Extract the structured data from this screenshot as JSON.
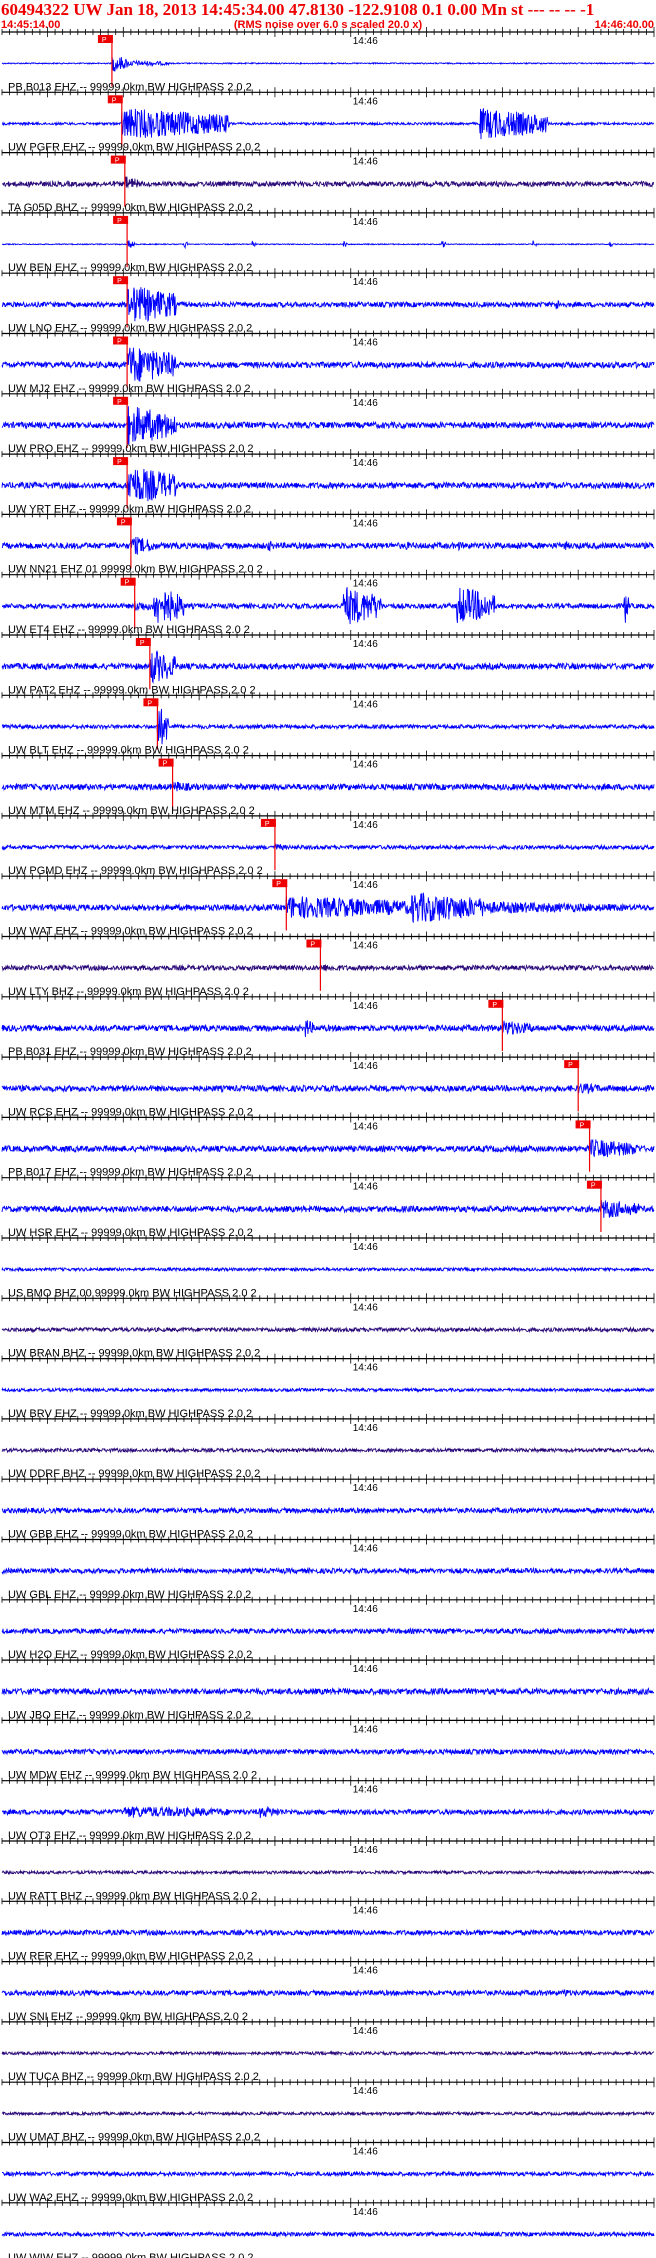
{
  "header": {
    "title": "60494322 UW Jan 18, 2013 14:45:34.00   47.8130 -122.9108  0.1 0.00 Mn st --- -- --  -1",
    "subtitle": "(RMS noise over 6.0 s scaled 20.0 x)",
    "time_start": "14:45:14.00",
    "time_end": "14:46:40.00"
  },
  "colors": {
    "trace": "#0000ff",
    "noisy_trace": "#2a0a7a",
    "pick": "#ee0000",
    "text": "#000000"
  },
  "chart_data": {
    "type": "seismogram-stack",
    "x_range": [
      "14:45:14.00",
      "14:46:40.00"
    ],
    "minute_label": "14:46",
    "pick_label": "P",
    "traces": [
      {
        "label": "",
        "pick": 14.5,
        "bursts": [
          [
            14.5,
            16.5,
            9
          ],
          [
            16.5,
            22,
            3
          ]
        ],
        "noise": 0.6,
        "color": "trace"
      },
      {
        "label": "PB B013 EHZ -- 99999.0km BW  HIGHPASS  2.0  2",
        "pick": 15.8,
        "bursts": [
          [
            15.8,
            30,
            16
          ],
          [
            63,
            72,
            16
          ]
        ],
        "noise": 1.2,
        "color": "trace"
      },
      {
        "label": "UW PGFR EHZ -- 99999.0km BW  HIGHPASS  2.0  2",
        "pick": 16.2,
        "bursts": [
          [
            16.2,
            18,
            8
          ]
        ],
        "noise": 2.5,
        "color": "noisy_trace"
      },
      {
        "label": "TA G05D BHZ -- 99999.0km BW  HIGHPASS  2.0  2",
        "pick": 16.5,
        "bursts": [
          [
            16.5,
            17.5,
            5
          ],
          [
            24,
            24.5,
            4
          ],
          [
            33,
            33.5,
            4
          ],
          [
            45,
            45.5,
            4
          ],
          [
            58,
            58.5,
            4
          ],
          [
            70,
            70.5,
            4
          ],
          [
            80,
            80.5,
            4
          ]
        ],
        "noise": 0.5,
        "color": "trace"
      },
      {
        "label": "UW BEN EHZ -- 99999.0km BW  HIGHPASS  2.0  2",
        "pick": 16.5,
        "bursts": [
          [
            16.5,
            23,
            20
          ],
          [
            73,
            74,
            6
          ]
        ],
        "noise": 2.5,
        "color": "trace"
      },
      {
        "label": "UW LNO EHZ -- 99999.0km BW  HIGHPASS  2.0  2",
        "pick": 16.5,
        "bursts": [
          [
            16.5,
            23,
            20
          ]
        ],
        "noise": 3,
        "color": "trace"
      },
      {
        "label": "UW MJ2 EHZ -- 99999.0km BW  HIGHPASS  2.0  2",
        "pick": 16.5,
        "bursts": [
          [
            16.5,
            23,
            20
          ]
        ],
        "noise": 3,
        "color": "trace"
      },
      {
        "label": "UW PRO EHZ -- 99999.0km BW  HIGHPASS  2.0  2",
        "pick": 16.5,
        "bursts": [
          [
            16.5,
            23,
            20
          ]
        ],
        "noise": 3,
        "color": "trace"
      },
      {
        "label": "UW YRT EHZ -- 99999.0km BW  HIGHPASS  2.0  2",
        "pick": 17.0,
        "bursts": [
          [
            17,
            20,
            10
          ],
          [
            27,
            28,
            5
          ],
          [
            35,
            36,
            6
          ],
          [
            53,
            54,
            5
          ],
          [
            60,
            61,
            5
          ],
          [
            68,
            69,
            5
          ],
          [
            74,
            75,
            5
          ]
        ],
        "noise": 3,
        "color": "trace"
      },
      {
        "label": "UW NN21 EHZ 01 99999.0km BW  HIGHPASS  2.0  2",
        "pick": 17.5,
        "bursts": [
          [
            17.5,
            20,
            6
          ],
          [
            20,
            24,
            20
          ],
          [
            45,
            50,
            20
          ],
          [
            60,
            65,
            20
          ],
          [
            82,
            82.7,
            20
          ]
        ],
        "noise": 2.5,
        "color": "trace"
      },
      {
        "label": "UW ET4 EHZ -- 99999.0km BW  HIGHPASS  2.0  2",
        "pick": 19.5,
        "bursts": [
          [
            19.5,
            23,
            18
          ]
        ],
        "noise": 3,
        "color": "trace"
      },
      {
        "label": "UW PAT2 EHZ -- 99999.0km BW  HIGHPASS  2.0  2",
        "pick": 20.5,
        "bursts": [
          [
            20.5,
            22,
            22
          ]
        ],
        "noise": 2,
        "color": "trace"
      },
      {
        "label": "UW BLT EHZ -- 99999.0km BW  HIGHPASS  2.0  2",
        "pick": 22.5,
        "bursts": [
          [
            22.5,
            25,
            6
          ]
        ],
        "noise": 3,
        "color": "trace"
      },
      {
        "label": "UW MTM EHZ -- 99999.0km BW  HIGHPASS  2.0  2",
        "pick": 36.0,
        "bursts": [
          [
            36,
            37.5,
            4
          ]
        ],
        "noise": 2,
        "color": "trace"
      },
      {
        "label": "UW PGMD EHZ -- 99999.0km BW  HIGHPASS  2.0  2",
        "pick": 37.5,
        "bursts": [
          [
            37.5,
            54,
            12
          ],
          [
            54,
            64,
            16
          ],
          [
            64,
            82,
            6
          ]
        ],
        "noise": 3,
        "color": "trace"
      },
      {
        "label": "UW WAT EHZ -- 99999.0km BW  HIGHPASS  2.0  2",
        "pick": 42.0,
        "bursts": [
          [
            42,
            46,
            4
          ]
        ],
        "noise": 2.5,
        "color": "noisy_trace"
      },
      {
        "label": "UW LTY BHZ -- 99999.0km BW  HIGHPASS  2.0  2",
        "pick": 66.0,
        "bursts": [
          [
            40,
            41,
            10
          ],
          [
            66,
            70,
            8
          ]
        ],
        "noise": 3,
        "color": "trace"
      },
      {
        "label": "PB B031 EHZ -- 99999.0km BW  HIGHPASS  2.0  2",
        "pick": 76.0,
        "bursts": [
          [
            76,
            79,
            6
          ]
        ],
        "noise": 3,
        "color": "trace"
      },
      {
        "label": "UW RCS EHZ -- 99999.0km BW  HIGHPASS  2.0  2",
        "pick": 77.5,
        "bursts": [
          [
            77.5,
            84,
            10
          ]
        ],
        "noise": 3,
        "color": "trace"
      },
      {
        "label": "PB B017 EHZ -- 99999.0km BW  HIGHPASS  2.0  2",
        "pick": 79.0,
        "bursts": [
          [
            79,
            84,
            10
          ]
        ],
        "noise": 3,
        "color": "trace"
      },
      {
        "label": "UW HSR EHZ -- 99999.0km BW  HIGHPASS  2.0  2",
        "pick": null,
        "bursts": [],
        "noise": 1.5,
        "color": "trace"
      },
      {
        "label": "US BMO BHZ 00 99999.0km BW  HIGHPASS  2.0  2",
        "pick": null,
        "bursts": [],
        "noise": 2,
        "color": "noisy_trace"
      },
      {
        "label": "UW BRAN BHZ -- 99999.0km BW  HIGHPASS  2.0  2",
        "pick": null,
        "bursts": [],
        "noise": 1.5,
        "color": "trace"
      },
      {
        "label": "UW BRV EHZ -- 99999.0km BW  HIGHPASS  2.0  2",
        "pick": null,
        "bursts": [],
        "noise": 1.8,
        "color": "noisy_trace"
      },
      {
        "label": "UW DDRF BHZ -- 99999.0km BW  HIGHPASS  2.0  2",
        "pick": null,
        "bursts": [],
        "noise": 2.5,
        "color": "trace"
      },
      {
        "label": "UW GBB EHZ -- 99999.0km BW  HIGHPASS  2.0  2",
        "pick": null,
        "bursts": [],
        "noise": 2.5,
        "color": "trace"
      },
      {
        "label": "UW GBL EHZ -- 99999.0km BW  HIGHPASS  2.0  2",
        "pick": null,
        "bursts": [],
        "noise": 2.5,
        "color": "trace"
      },
      {
        "label": "UW H2O EHZ -- 99999.0km BW  HIGHPASS  2.0  2",
        "pick": null,
        "bursts": [],
        "noise": 3,
        "color": "trace"
      },
      {
        "label": "UW JBO EHZ -- 99999.0km BW  HIGHPASS  2.0  2",
        "pick": null,
        "bursts": [],
        "noise": 2.5,
        "color": "trace"
      },
      {
        "label": "UW MDW EHZ -- 99999.0km BW  HIGHPASS  2.0  2",
        "pick": null,
        "bursts": [
          [
            16,
            30,
            6
          ],
          [
            34,
            37,
            6
          ]
        ],
        "noise": 2.5,
        "color": "trace"
      },
      {
        "label": "UW OT3 EHZ -- 99999.0km BW  HIGHPASS  2.0  2",
        "pick": null,
        "bursts": [],
        "noise": 1.5,
        "color": "noisy_trace"
      },
      {
        "label": "UW RATT BHZ -- 99999.0km BW  HIGHPASS  2.0  2",
        "pick": null,
        "bursts": [],
        "noise": 2.5,
        "color": "trace"
      },
      {
        "label": "UW RER EHZ -- 99999.0km BW  HIGHPASS  2.0  2",
        "pick": null,
        "bursts": [
          [
            74,
            75,
            5
          ]
        ],
        "noise": 2.5,
        "color": "trace"
      },
      {
        "label": "UW SNI EHZ -- 99999.0km BW  HIGHPASS  2.0  2",
        "pick": null,
        "bursts": [],
        "noise": 1.5,
        "color": "noisy_trace"
      },
      {
        "label": "UW TUCA BHZ -- 99999.0km BW  HIGHPASS  2.0  2",
        "pick": null,
        "bursts": [],
        "noise": 1.5,
        "color": "noisy_trace"
      },
      {
        "label": "UW UMAT BHZ -- 99999.0km BW  HIGHPASS  2.0  2",
        "pick": null,
        "bursts": [],
        "noise": 2,
        "color": "trace"
      },
      {
        "label": "UW WA2 EHZ -- 99999.0km BW  HIGHPASS  2.0  2",
        "pick": null,
        "bursts": [],
        "noise": 2,
        "color": "trace"
      },
      {
        "label": "UW WIW EHZ -- 99999.0km BW  HIGHPASS  2.0  2",
        "pick": null,
        "bursts": [],
        "noise": 1.5,
        "color": "trace"
      }
    ]
  }
}
